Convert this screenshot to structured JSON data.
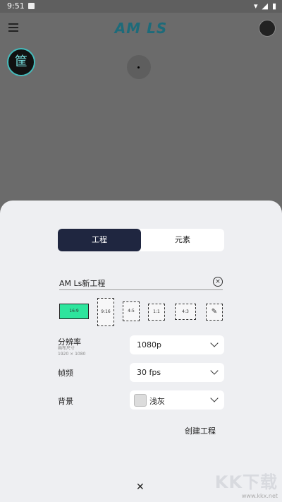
{
  "status_bar": {
    "time": "9:51"
  },
  "app_bar": {
    "logo_text": "AM LS"
  },
  "badge": {
    "text": "筐"
  },
  "sheet": {
    "tabs": [
      {
        "label": "工程"
      },
      {
        "label": "元素"
      }
    ],
    "project_name": "AM Ls新工程",
    "aspect_ratios": [
      {
        "label": "16:9"
      },
      {
        "label": "9:16"
      },
      {
        "label": "4:5"
      },
      {
        "label": "1:1"
      },
      {
        "label": "4:3"
      }
    ],
    "resolution": {
      "label": "分辨率",
      "sublabel_1": "画布尺寸",
      "sublabel_2": "1920 × 1080",
      "value": "1080p"
    },
    "fps": {
      "label": "帧频",
      "value": "30 fps"
    },
    "background": {
      "label": "背景",
      "value": "浅灰",
      "swatch_color": "#dcdcdc"
    },
    "create_label": "创建工程",
    "close_label": "✕"
  },
  "watermark": {
    "brand": "KK下载",
    "url": "www.kkx.net"
  },
  "colors": {
    "accent": "#2de59d",
    "tab_active": "#1f2640"
  }
}
